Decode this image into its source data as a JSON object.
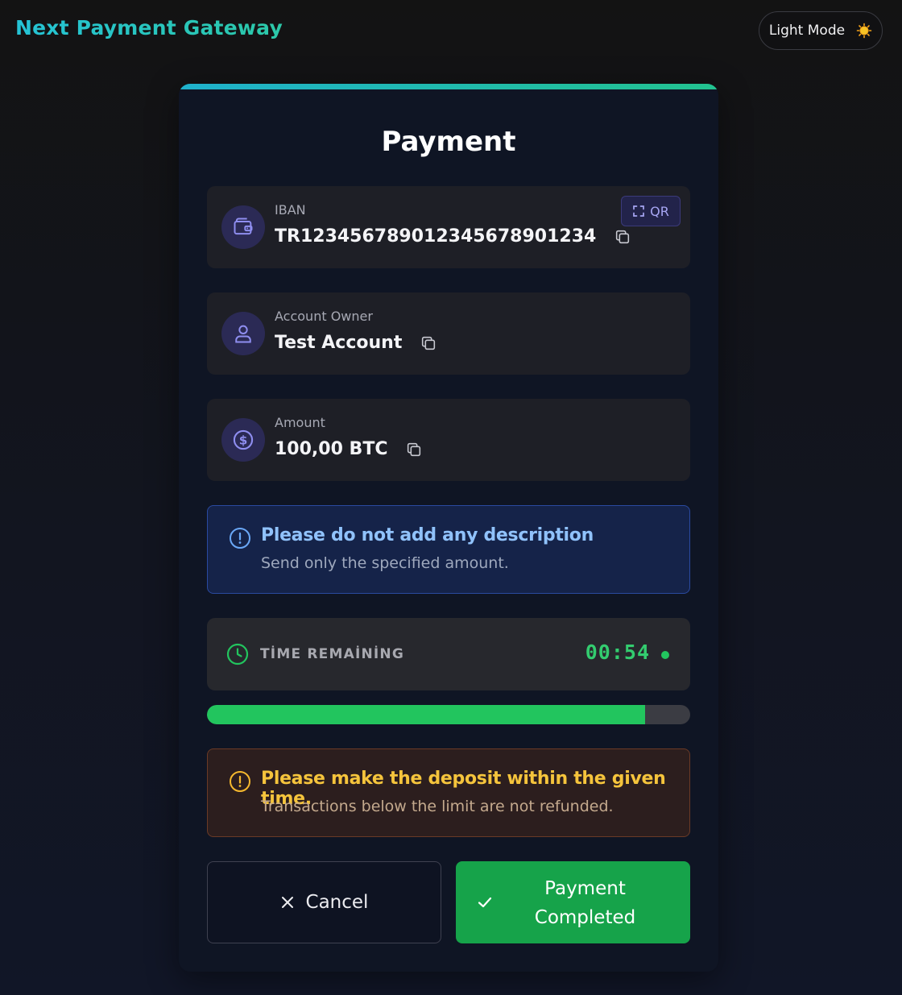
{
  "header": {
    "brand": "Next Payment Gateway",
    "theme_toggle_label": "Light Mode"
  },
  "card": {
    "title": "Payment",
    "iban": {
      "label": "IBAN",
      "value": "TR1234567890123456789012​34",
      "qr_label": "QR"
    },
    "owner": {
      "label": "Account Owner",
      "value": "Test Account"
    },
    "amount": {
      "label": "Amount",
      "value": "100,00 BTC"
    },
    "info_notice": {
      "title": "Please do not add any description",
      "body": "Send only the specified amount."
    },
    "timer": {
      "label": "TİME REMAİNİNG",
      "value": "00:54",
      "progress_fraction": 0.907
    },
    "warning_notice": {
      "title": "Please make the deposit within the given time.",
      "body": "Transactions below the limit are not refunded."
    },
    "actions": {
      "cancel_label": "Cancel",
      "complete_label": "Payment Completed"
    }
  },
  "colors": {
    "accent_teal": "#22c38f",
    "progress_green": "#22c55e",
    "info_blue": "#90c2fb",
    "warning_yellow": "#f5c43c",
    "primary_button": "#16a34a"
  }
}
